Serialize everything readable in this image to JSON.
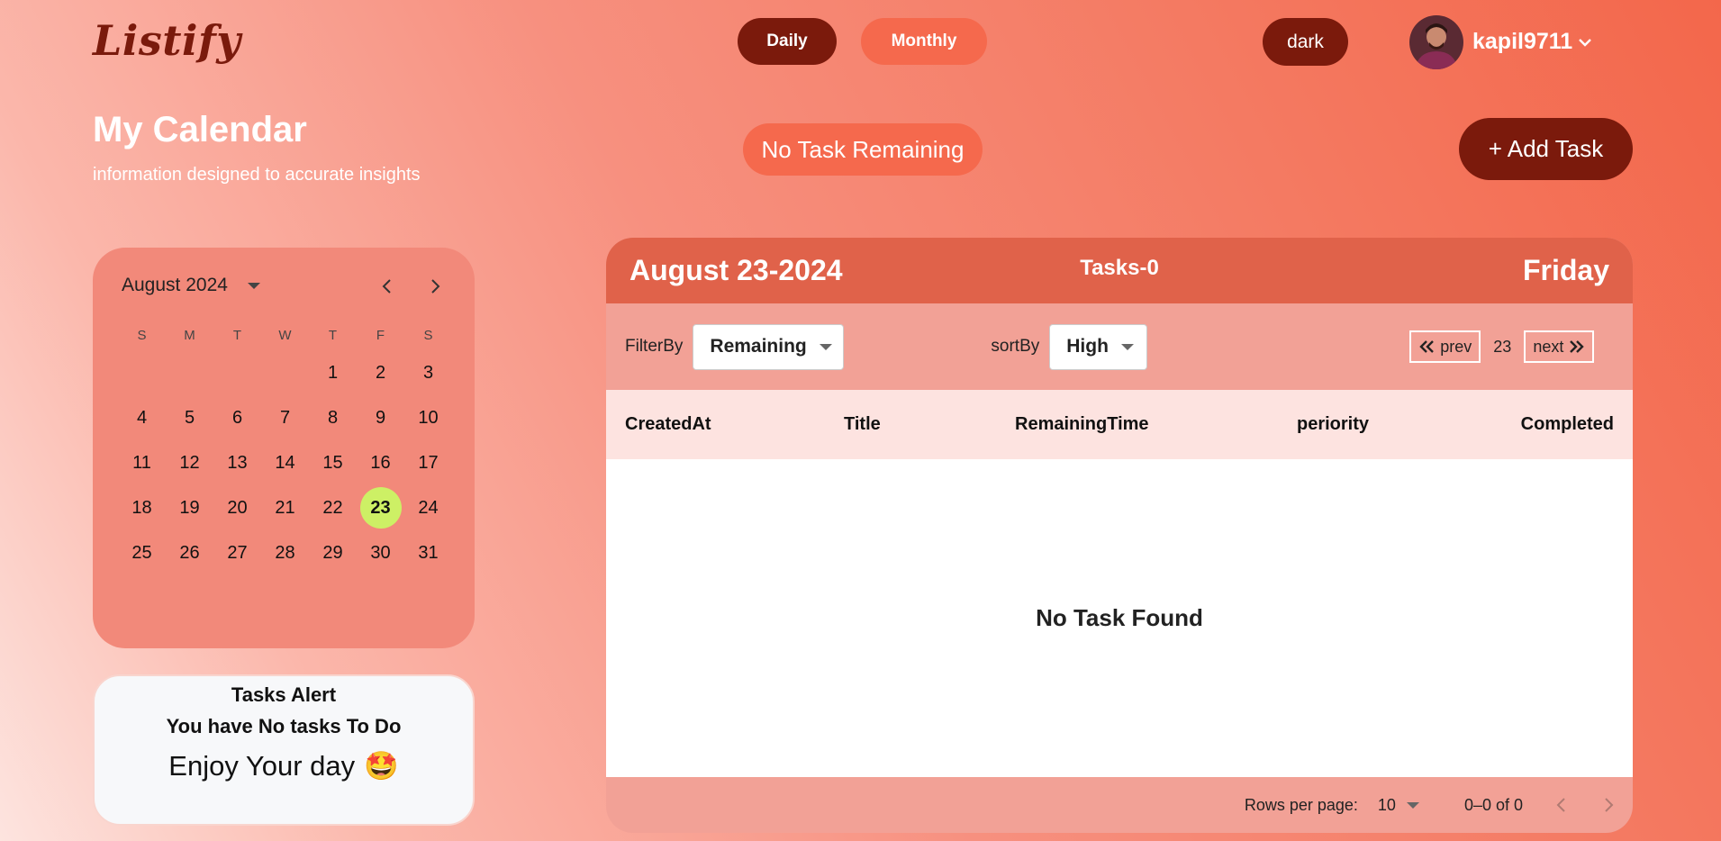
{
  "header": {
    "logo": "Listify",
    "view_tabs": [
      {
        "label": "Daily"
      },
      {
        "label": "Monthly"
      }
    ],
    "theme_toggle": "dark",
    "user": {
      "name": "kapil9711"
    }
  },
  "page": {
    "title": "My Calendar",
    "subtitle": "information designed to accurate insights",
    "remaining_status": "No Task Remaining",
    "add_task_label": "+ Add Task"
  },
  "calendar": {
    "month_label": "August 2024",
    "weekday_headers": [
      "S",
      "M",
      "T",
      "W",
      "T",
      "F",
      "S"
    ],
    "leading_blanks": 4,
    "days_in_month": 31,
    "selected_day": 23,
    "selected_color": "#cdf065"
  },
  "alert": {
    "title": "Tasks Alert",
    "message": "You have No tasks To Do",
    "enjoy": "Enjoy Your day",
    "emoji": "🤩"
  },
  "panel": {
    "date": "August 23-2024",
    "tasks_count": "Tasks-0",
    "weekday": "Friday",
    "filter_label": "FilterBy",
    "filter_value": "Remaining",
    "sort_label": "sortBy",
    "sort_value": "High",
    "prev_label": "prev",
    "current_page": "23",
    "next_label": "next",
    "columns": [
      "CreatedAt",
      "Title",
      "RemainingTime",
      "periority",
      "Completed"
    ],
    "empty_message": "No Task Found",
    "rows_per_page_label": "Rows per page:",
    "rows_per_page_value": "10",
    "range_label": "0–0 of 0"
  },
  "colors": {
    "brand_dark": "#7b1a0c",
    "accent": "#f5694d",
    "panel_header": "#e0624a"
  }
}
